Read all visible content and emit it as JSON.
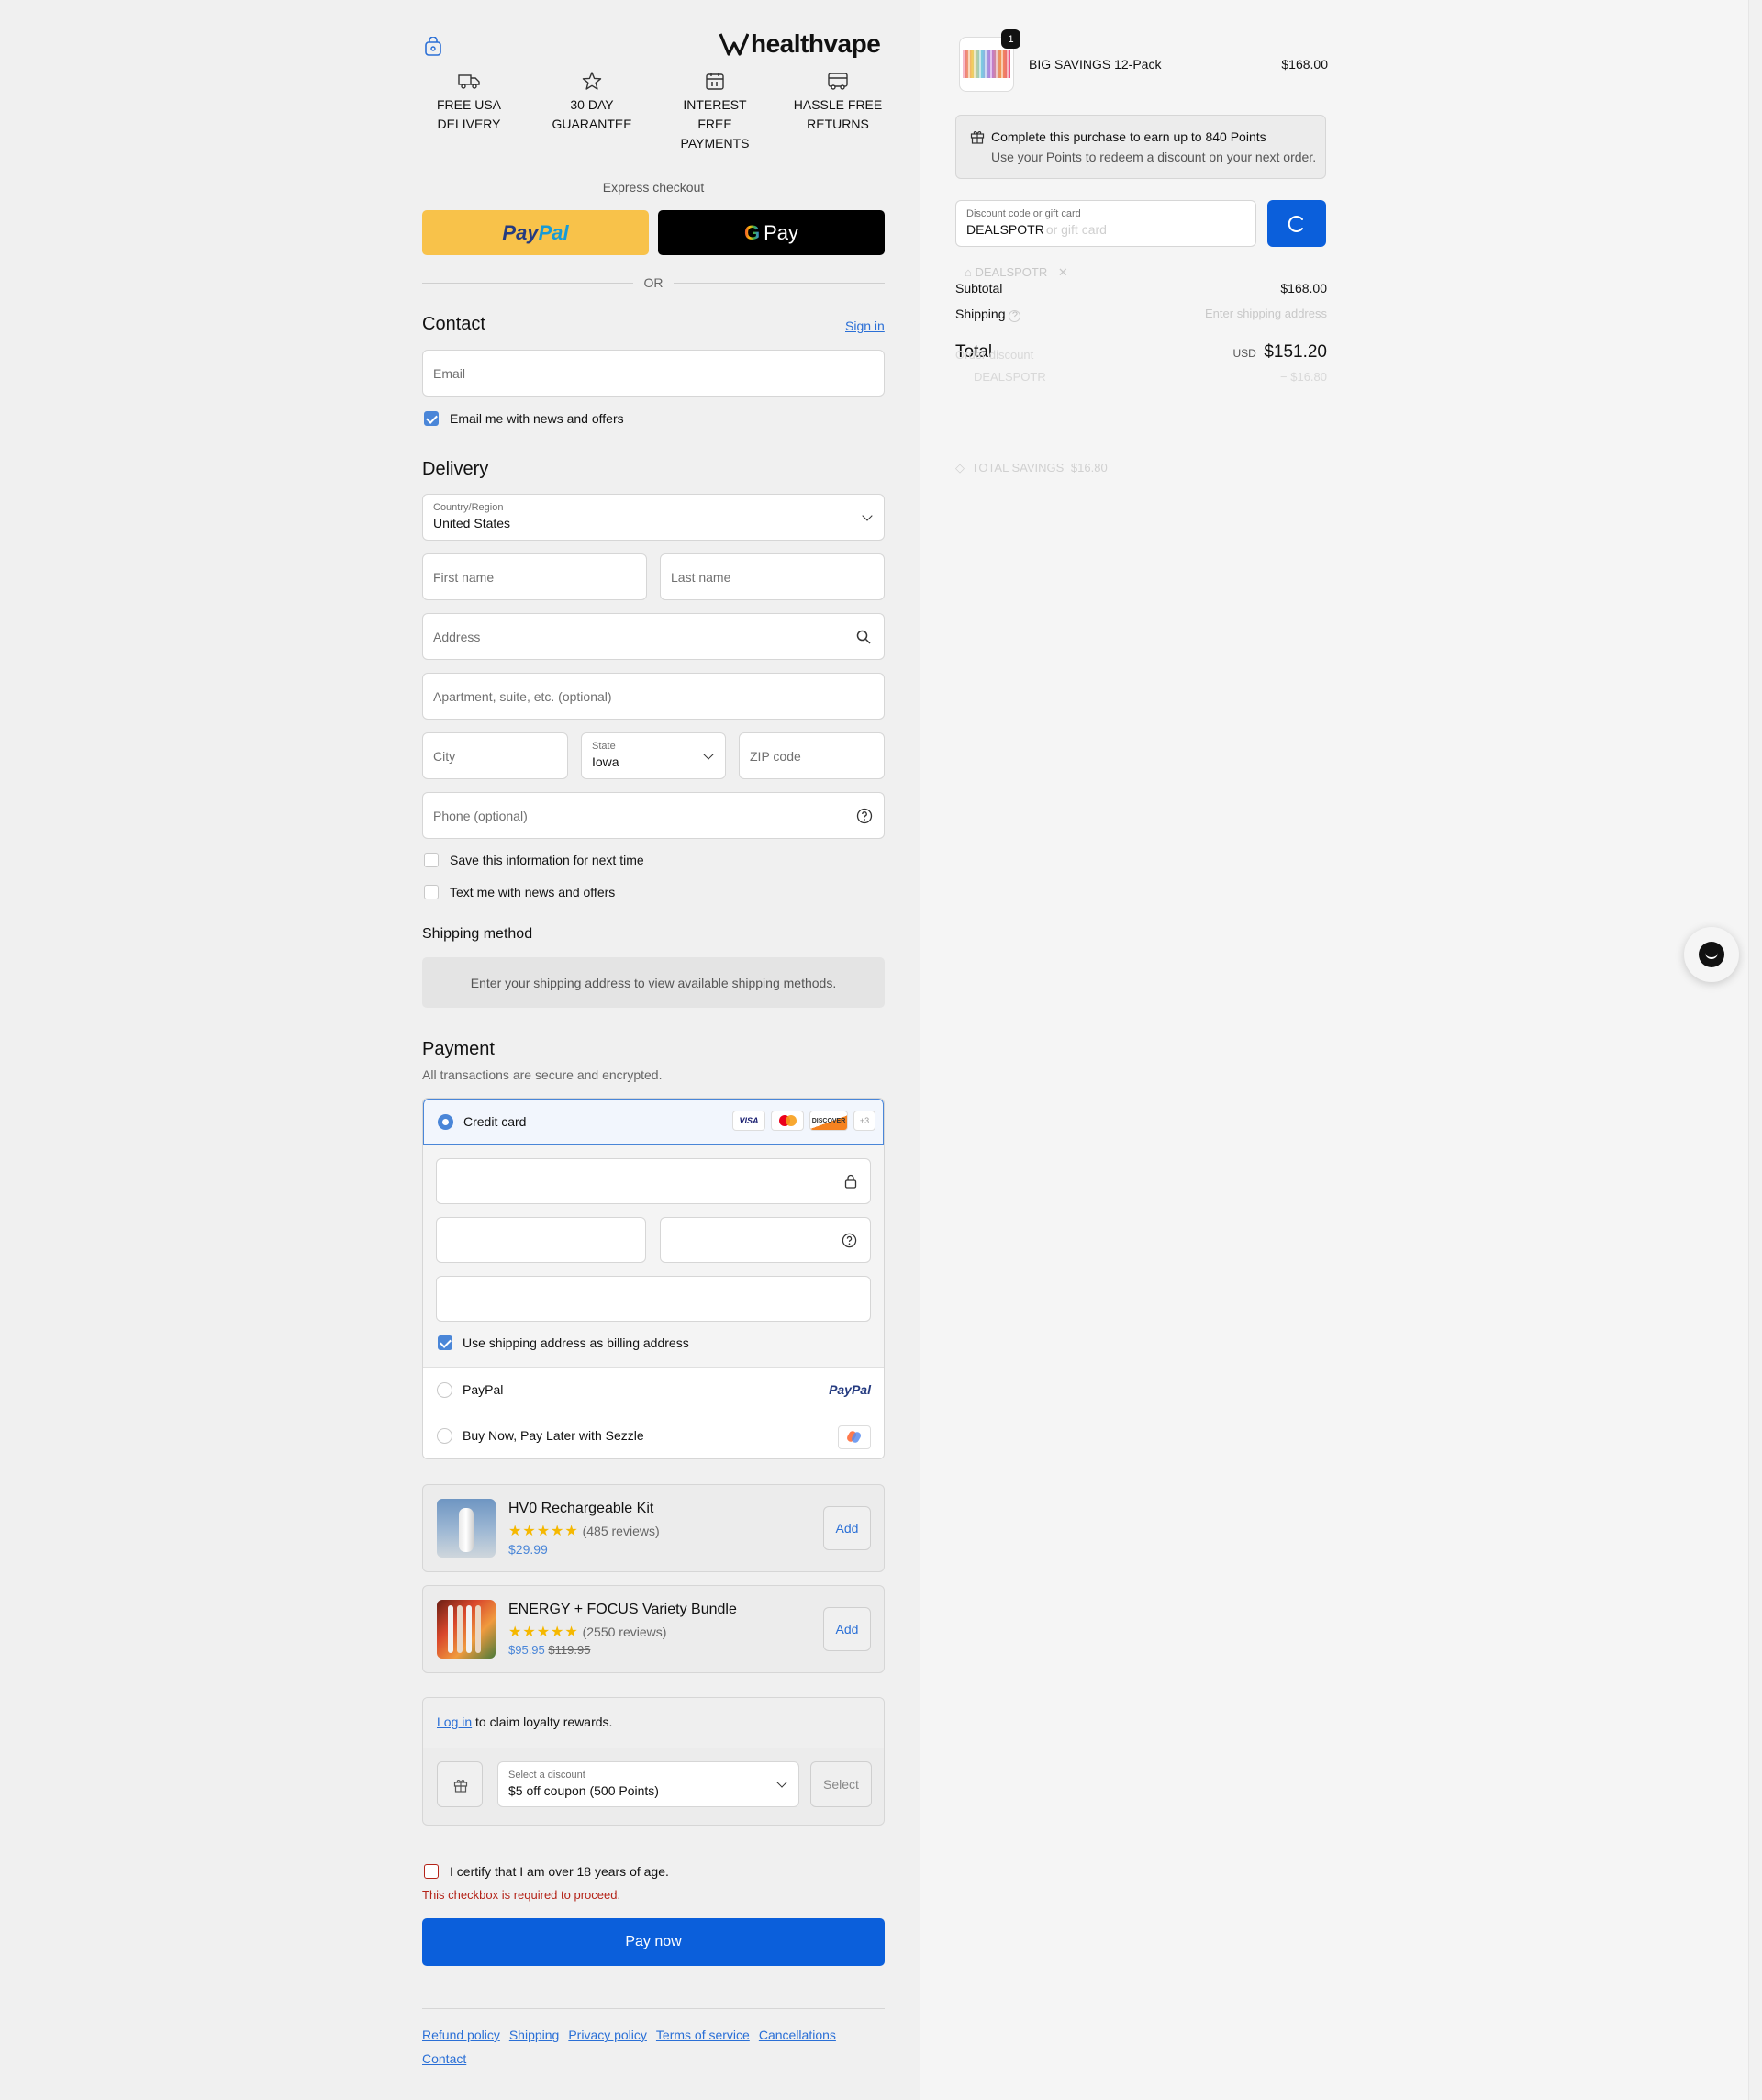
{
  "brand": {
    "logo_text": "healthvape"
  },
  "trust_badges": [
    {
      "icon": "truck-icon",
      "label": "FREE USA DELIVERY"
    },
    {
      "icon": "star-icon",
      "label": "30 DAY GUARANTEE"
    },
    {
      "icon": "calendar-icon",
      "label": "INTEREST FREE PAYMENTS"
    },
    {
      "icon": "box-return-icon",
      "label": "HASSLE FREE RETURNS"
    }
  ],
  "express": {
    "label": "Express checkout",
    "paypal_left": "Pay",
    "paypal_right": "Pal",
    "gpay": "Pay",
    "or": "OR"
  },
  "contact": {
    "title": "Contact",
    "sign_in": "Sign in",
    "email_placeholder": "Email",
    "newsletter_label": "Email me with news and offers"
  },
  "delivery": {
    "title": "Delivery",
    "country_label": "Country/Region",
    "country_value": "United States",
    "first_name": "First name",
    "last_name": "Last name",
    "address": "Address",
    "apartment": "Apartment, suite, etc. (optional)",
    "city": "City",
    "state_label": "State",
    "state_value": "Iowa",
    "zip": "ZIP code",
    "phone": "Phone (optional)",
    "save_info": "Save this information for next time",
    "text_me": "Text me with news and offers"
  },
  "shipping": {
    "title": "Shipping method",
    "notice": "Enter your shipping address to view available shipping methods."
  },
  "payment": {
    "title": "Payment",
    "subtitle": "All transactions are secure and encrypted.",
    "credit_card": "Credit card",
    "card_badges": [
      "VISA",
      "",
      "DISCOVER",
      "+3"
    ],
    "billing_same": "Use shipping address as billing address",
    "paypal": "PayPal",
    "paypal_logo": "PayPal",
    "sezzle": "Buy Now, Pay Later with Sezzle"
  },
  "upsells": [
    {
      "name": "HV0 Rechargeable Kit",
      "stars": "★★★★★",
      "reviews": "(485 reviews)",
      "price": "$29.99",
      "compare": "",
      "add": "Add"
    },
    {
      "name": "ENERGY + FOCUS Variety Bundle",
      "stars": "★★★★★",
      "reviews": "(2550 reviews)",
      "price": "$95.95",
      "compare": "$119.95",
      "add": "Add"
    }
  ],
  "loyalty": {
    "login": "Log in",
    "claim_text": " to claim loyalty rewards.",
    "select_label": "Select a discount",
    "select_value": "$5 off coupon (500 Points)",
    "select_btn": "Select"
  },
  "age": {
    "label": "I certify that I am over 18 years of age.",
    "error": "This checkbox is required to proceed."
  },
  "pay_now": "Pay now",
  "footer": {
    "links": [
      "Refund policy",
      "Shipping",
      "Privacy policy",
      "Terms of service",
      "Cancellations",
      "Contact"
    ]
  },
  "summary": {
    "item_qty": "1",
    "item_name": "BIG SAVINGS 12-Pack",
    "item_price": "$168.00",
    "points_title": "Complete this purchase to earn up to 840 Points",
    "points_sub": "Use your Points to redeem a discount on your next order.",
    "discount_label": "Discount code or gift card",
    "discount_value": "DEALSPOTR",
    "discount_ghost": "or gift card",
    "applied_code": "DEALSPOTR",
    "subtotal_label": "Subtotal",
    "subtotal": "$168.00",
    "shipping_label": "Shipping",
    "shipping_value": "Enter shipping address",
    "total_label": "Total",
    "currency": "USD",
    "total": "$151.20",
    "order_discount_label": "Order discount",
    "order_discount_code": "DEALSPOTR",
    "order_discount_value": "− $16.80",
    "total_savings_label": "TOTAL SAVINGS",
    "total_savings_value": "$16.80"
  },
  "colors": {
    "accent": "#0b5fdb",
    "paypal_yellow": "#f8c24a",
    "error": "#b42318",
    "link": "#2a6fd6"
  }
}
